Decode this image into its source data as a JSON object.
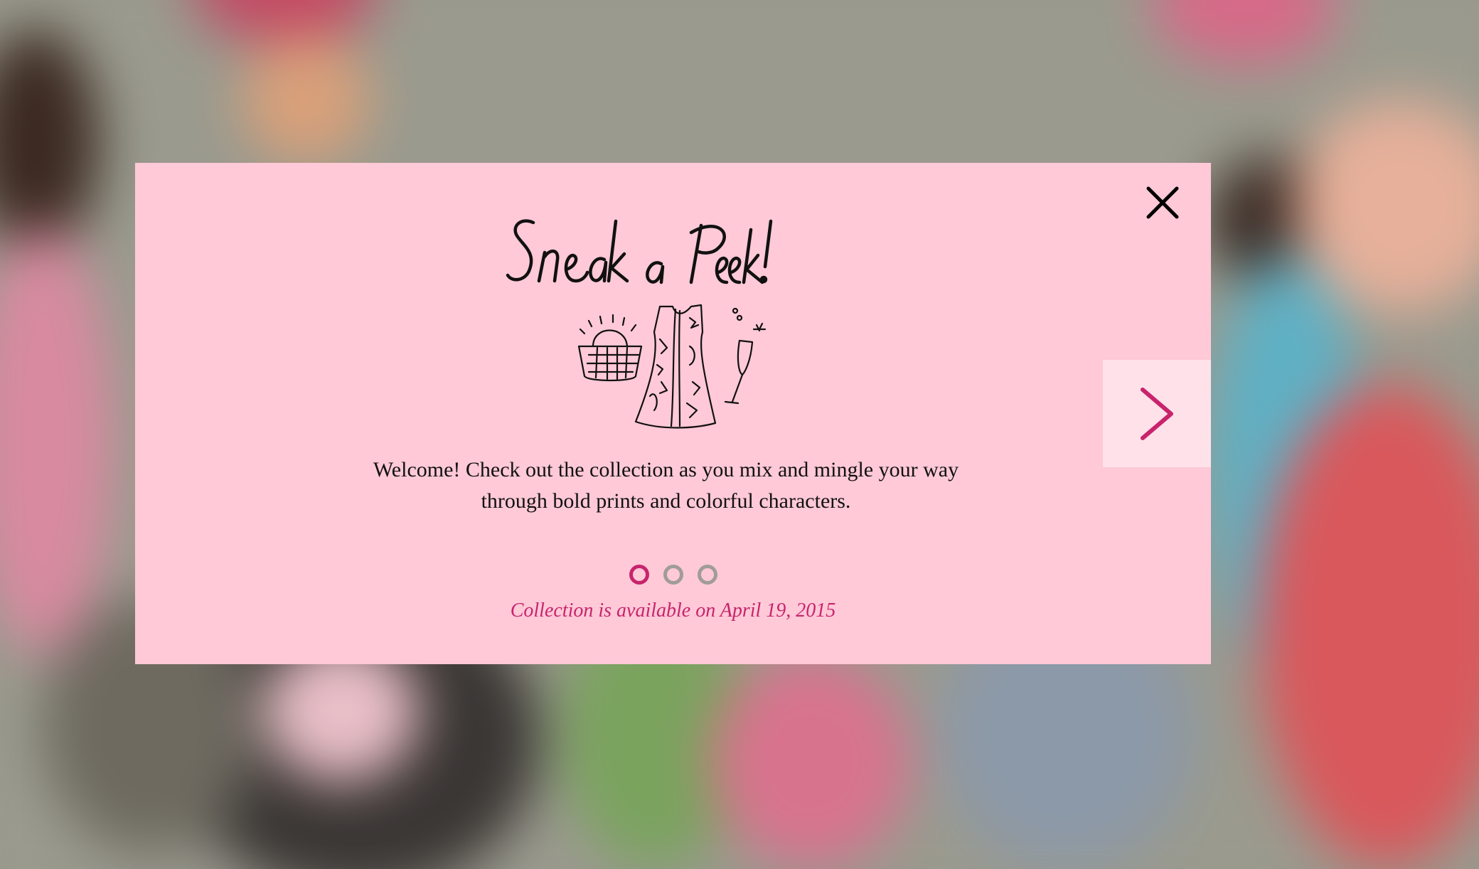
{
  "modal": {
    "headline": "Sneak a Peek!",
    "illustration_icons": [
      "handbag-icon",
      "dress-icon",
      "champagne-glass-icon"
    ],
    "welcome_text": "Welcome! Check out the collection as you mix and mingle your way through bold prints and colorful characters.",
    "availability_text": "Collection is available on April 19, 2015",
    "pagination": {
      "total": 3,
      "current": 1
    },
    "close_icon": "close-icon",
    "next_icon": "chevron-right-icon"
  },
  "colors": {
    "modal_bg": "#ffc9d7",
    "next_bg": "#ffe1e9",
    "accent": "#c8236c",
    "inactive_dot": "#a09c9a",
    "text": "#111111"
  }
}
